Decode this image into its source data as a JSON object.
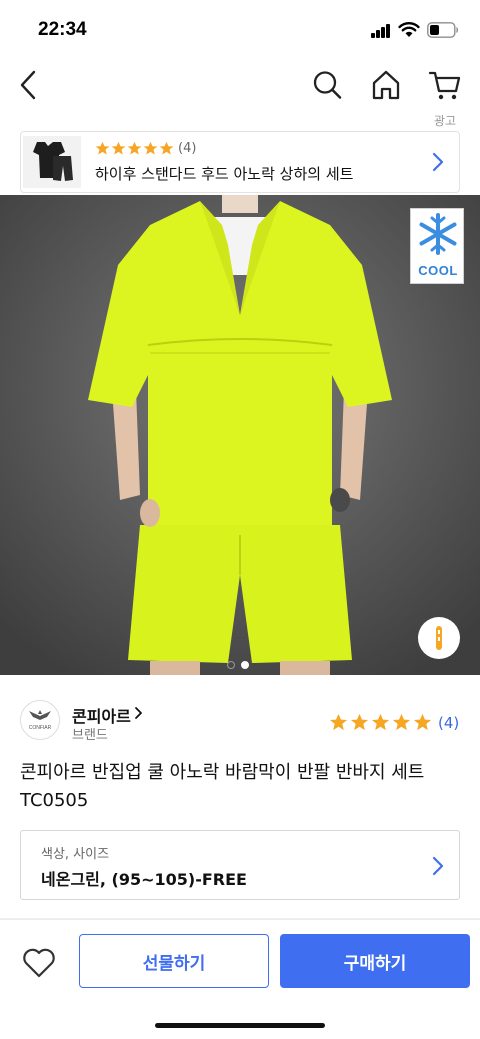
{
  "status_bar": {
    "time": "22:34"
  },
  "nav": {
    "back_icon": "chevron-left-icon",
    "search_icon": "search-icon",
    "home_icon": "home-icon",
    "cart_icon": "cart-icon"
  },
  "ad": {
    "label": "광고",
    "rating_count": "(4)",
    "title": "하이후 스탠다드 후드 아노락 상하의 세트"
  },
  "hero": {
    "badge_text": "COOL",
    "image_count": 2,
    "active_index": 1
  },
  "brand": {
    "logo_text": "CONFIAR",
    "name": "콘피아르",
    "sub_label": "브랜드"
  },
  "rating": {
    "stars": 5,
    "count": "(4)"
  },
  "product": {
    "title": "콘피아르 반집업 쿨 아노락 바람막이 반팔 반바지 세트 TC0505"
  },
  "option": {
    "label": "색상, 사이즈",
    "value": "네온그린, (95~105)-FREE"
  },
  "bottom_bar": {
    "gift_label": "선물하기",
    "buy_label": "구매하기"
  },
  "colors": {
    "accent": "#3f6ff0",
    "star": "#f5a623",
    "neon": "#dcf520"
  }
}
